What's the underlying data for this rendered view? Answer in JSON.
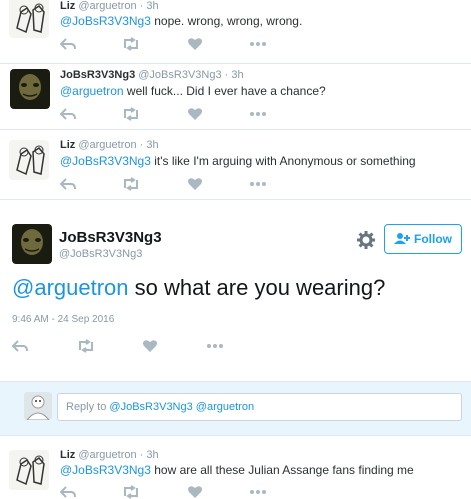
{
  "tweets": [
    {
      "name": "Liz",
      "handle": "@arguetron",
      "sep": "·",
      "time": "3h",
      "mention": "@JoBsR3V3Ng3",
      "text": " nope. wrong, wrong, wrong."
    },
    {
      "name": "JoBsR3V3Ng3",
      "handle": "@JoBsR3V3Ng3",
      "sep": "·",
      "time": "3h",
      "mention": "@arguetron",
      "text": " well fuck... Did I ever have a chance?"
    },
    {
      "name": "Liz",
      "handle": "@arguetron",
      "sep": "·",
      "time": "3h",
      "mention": "@JoBsR3V3Ng3",
      "text": " it's like I'm arguing with Anonymous or something"
    },
    {
      "name": "Liz",
      "handle": "@arguetron",
      "sep": "·",
      "time": "3h",
      "mention": "@JoBsR3V3Ng3",
      "text": " how are all these Julian Assange fans finding me"
    }
  ],
  "main": {
    "name": "JoBsR3V3Ng3",
    "handle": "@JoBsR3V3Ng3",
    "follow_label": "Follow",
    "mention": "@arguetron",
    "text": " so what are you wearing?",
    "timestamp": "9:46 AM - 24 Sep 2016"
  },
  "reply": {
    "prefix": "Reply to ",
    "mention1": "@JoBsR3V3Ng3",
    "mention2": " @arguetron"
  },
  "icons": {
    "reply": "reply-icon",
    "retweet": "retweet-icon",
    "like": "heart-icon",
    "more": "more-icon",
    "gear": "gear-icon",
    "follow": "add-user-icon"
  },
  "colors": {
    "link": "#1b95e0",
    "follow": "#1da1f2",
    "muted": "#8899a6",
    "reply_bg": "#e8f5fd"
  }
}
